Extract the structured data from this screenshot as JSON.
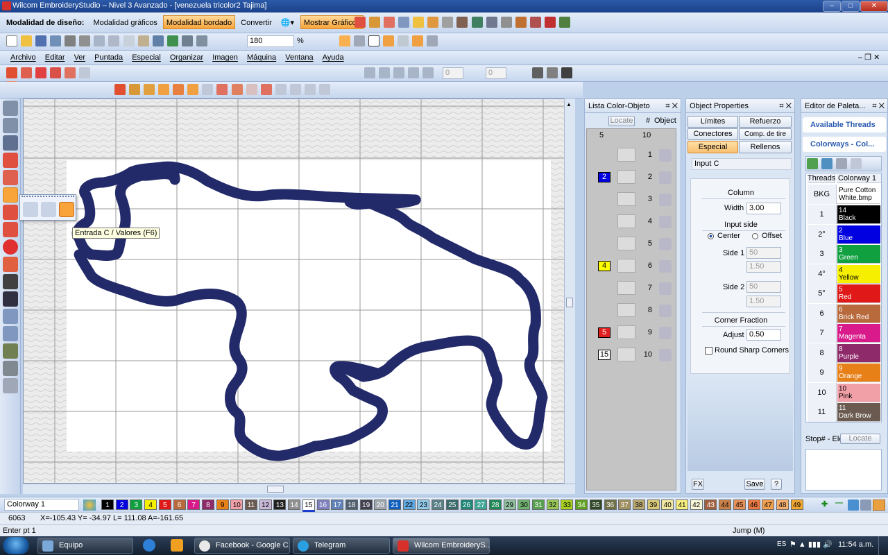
{
  "window": {
    "title": "Wilcom EmbroideryStudio – Nivel 3 Avanzado - [venezuela tricolor2          Tajima]",
    "controls": [
      "–",
      "□",
      "✕"
    ]
  },
  "mode_bar": {
    "label": "Modalidad de diseño:",
    "buttons": [
      "Modalidad gráficos",
      "Modalidad bordado",
      "Convertir"
    ],
    "active": "Modalidad bordado",
    "show_graphics": "Mostrar Gráficos"
  },
  "std_toolbar": {
    "zoom_value": "180",
    "zoom_unit": "%"
  },
  "menu": [
    "Archivo",
    "Editar",
    "Ver",
    "Puntada",
    "Especial",
    "Organizar",
    "Imagen",
    "Máquina",
    "Ventana",
    "Ayuda"
  ],
  "transform_bar": {
    "rotate_value": "0",
    "skew_value": "0"
  },
  "tool_flyout": {
    "tooltip": "Entrada C / Valores (F6)"
  },
  "color_object_list": {
    "title": "Lista Color-Objeto",
    "locate": "Locate",
    "header_num": "#",
    "header_obj": "Object",
    "col_count": "5",
    "col_count2": "10",
    "rows": [
      {
        "num": "1"
      },
      {
        "num": "2",
        "swatch": "2",
        "color": "#0000e0"
      },
      {
        "num": "3"
      },
      {
        "num": "4"
      },
      {
        "num": "5"
      },
      {
        "num": "6",
        "swatch": "4",
        "color": "#ffff00"
      },
      {
        "num": "7"
      },
      {
        "num": "8"
      },
      {
        "num": "9",
        "swatch": "5",
        "color": "#e02020"
      },
      {
        "num": "10",
        "swatch": "15",
        "color": "#ffffff"
      }
    ]
  },
  "object_properties": {
    "title": "Object Properties",
    "tabs": [
      "Límites",
      "Refuerzo",
      "Conectores",
      "Comp. de tire",
      "Especial",
      "Rellenos"
    ],
    "active_tab": "Especial",
    "input_type": "Input C",
    "column_label": "Column",
    "width_label": "Width",
    "width_value": "3.00",
    "input_side_label": "Input side",
    "center_label": "Center",
    "offset_label": "Offset",
    "side1_label": "Side 1",
    "side1_value": "50",
    "side1_value2": "1.50",
    "side2_label": "Side 2",
    "side2_value": "50",
    "side2_value2": "1.50",
    "corner_label": "Corner Fraction",
    "adjust_label": "Adjust",
    "adjust_value": "0.50",
    "round_label": "Round Sharp Corners",
    "fx_label": "FX",
    "save_label": "Save",
    "help_label": "?"
  },
  "palette_editor": {
    "title": "Editor de Paleta...",
    "available": "Available Threads",
    "colorways": "Colorways - Col...",
    "col_threads": "Threads",
    "col_colorway": "Colorway 1",
    "bkg_label": "BKG",
    "bkg_value": "Pure Cotton White.bmp",
    "threads": [
      {
        "num": "1",
        "code": "14",
        "name": "Black",
        "color": "#000000"
      },
      {
        "num": "2°",
        "code": "2",
        "name": "Blue",
        "color": "#0000e0"
      },
      {
        "num": "3",
        "code": "3",
        "name": "Green",
        "color": "#10a040"
      },
      {
        "num": "4°",
        "code": "4",
        "name": "Yellow",
        "color": "#f6f000"
      },
      {
        "num": "5°",
        "code": "5",
        "name": "Red",
        "color": "#e01818"
      },
      {
        "num": "6",
        "code": "6",
        "name": "Brick Red",
        "color": "#b86a3c"
      },
      {
        "num": "7",
        "code": "7",
        "name": "Magenta",
        "color": "#d81a8a"
      },
      {
        "num": "8",
        "code": "8",
        "name": "Purple",
        "color": "#8e2a6a"
      },
      {
        "num": "9",
        "code": "9",
        "name": "Orange",
        "color": "#e88018"
      },
      {
        "num": "10",
        "code": "10",
        "name": "Pink",
        "color": "#f2a0a8"
      },
      {
        "num": "11",
        "code": "11",
        "name": "Dark Brow",
        "color": "#6a5a50"
      }
    ],
    "stop_label": "Stop# - Ele",
    "locate": "Locate"
  },
  "thread_bar": {
    "colorway": "Colorway 1",
    "active": "15",
    "items": [
      {
        "n": "1",
        "c": "#000000",
        "t": "#fff"
      },
      {
        "n": "2",
        "c": "#0000e0",
        "t": "#fff"
      },
      {
        "n": "3",
        "c": "#10a040",
        "t": "#fff"
      },
      {
        "n": "4",
        "c": "#f6f000",
        "t": "#000"
      },
      {
        "n": "5",
        "c": "#e01818",
        "t": "#fff"
      },
      {
        "n": "6",
        "c": "#b86a3c",
        "t": "#fff"
      },
      {
        "n": "7",
        "c": "#d81a8a",
        "t": "#fff"
      },
      {
        "n": "8",
        "c": "#8e2a6a",
        "t": "#fff"
      },
      {
        "n": "9",
        "c": "#e88018",
        "t": "#000"
      },
      {
        "n": "10",
        "c": "#f2a0a8",
        "t": "#000"
      },
      {
        "n": "11",
        "c": "#6a5a50",
        "t": "#fff"
      },
      {
        "n": "12",
        "c": "#c8b8d8",
        "t": "#000"
      },
      {
        "n": "13",
        "c": "#202020",
        "t": "#fff"
      },
      {
        "n": "14",
        "c": "#909090",
        "t": "#fff"
      },
      {
        "n": "15",
        "c": "#ffffff",
        "t": "#000"
      },
      {
        "n": "16",
        "c": "#8080c0",
        "t": "#fff"
      },
      {
        "n": "17",
        "c": "#6080b8",
        "t": "#fff"
      },
      {
        "n": "18",
        "c": "#506070",
        "t": "#fff"
      },
      {
        "n": "19",
        "c": "#404050",
        "t": "#fff"
      },
      {
        "n": "20",
        "c": "#a0a8b0",
        "t": "#fff"
      },
      {
        "n": "21",
        "c": "#1060c0",
        "t": "#fff"
      },
      {
        "n": "22",
        "c": "#60a8e0",
        "t": "#000"
      },
      {
        "n": "23",
        "c": "#90c8e8",
        "t": "#000"
      },
      {
        "n": "24",
        "c": "#5a8088",
        "t": "#fff"
      },
      {
        "n": "25",
        "c": "#3a6a6a",
        "t": "#fff"
      },
      {
        "n": "26",
        "c": "#208878",
        "t": "#fff"
      },
      {
        "n": "27",
        "c": "#40a898",
        "t": "#fff"
      },
      {
        "n": "28",
        "c": "#208858",
        "t": "#fff"
      },
      {
        "n": "29",
        "c": "#90c0a0",
        "t": "#000"
      },
      {
        "n": "30",
        "c": "#70b070",
        "t": "#000"
      },
      {
        "n": "31",
        "c": "#58a050",
        "t": "#fff"
      },
      {
        "n": "32",
        "c": "#98c858",
        "t": "#000"
      },
      {
        "n": "33",
        "c": "#a8d020",
        "t": "#000"
      },
      {
        "n": "34",
        "c": "#60a020",
        "t": "#fff"
      },
      {
        "n": "35",
        "c": "#304828",
        "t": "#fff"
      },
      {
        "n": "36",
        "c": "#707048",
        "t": "#fff"
      },
      {
        "n": "37",
        "c": "#a09060",
        "t": "#fff"
      },
      {
        "n": "38",
        "c": "#b8a870",
        "t": "#000"
      },
      {
        "n": "39",
        "c": "#d8c878",
        "t": "#000"
      },
      {
        "n": "40",
        "c": "#f0e8a0",
        "t": "#000"
      },
      {
        "n": "41",
        "c": "#f8f080",
        "t": "#000"
      },
      {
        "n": "42",
        "c": "#f8f8d8",
        "t": "#000"
      },
      {
        "n": "43",
        "c": "#a06040",
        "t": "#fff"
      },
      {
        "n": "44",
        "c": "#c88048",
        "t": "#000"
      },
      {
        "n": "45",
        "c": "#e89058",
        "t": "#000"
      },
      {
        "n": "46",
        "c": "#e87840",
        "t": "#000"
      },
      {
        "n": "47",
        "c": "#f0a050",
        "t": "#000"
      },
      {
        "n": "48",
        "c": "#f8b070",
        "t": "#000"
      },
      {
        "n": "49",
        "c": "#f0a830",
        "t": "#000"
      }
    ]
  },
  "status": {
    "stitches": "6063",
    "coords": "X=-105.43 Y= -34.97 L= 111.08 A=-161.65",
    "prompt": "Enter pt 1",
    "jump": "Jump (M)"
  },
  "taskbar": {
    "tasks": [
      "Equipo",
      "Facebook - Google C...",
      "Telegram",
      "Wilcom EmbroideryS..."
    ],
    "time": "11:54 a.m.",
    "lang": "ES"
  },
  "colors": {
    "outline": "#232a6a",
    "accent_orange": "#f8a43b",
    "chrome_blue": "#bcd0ea"
  }
}
